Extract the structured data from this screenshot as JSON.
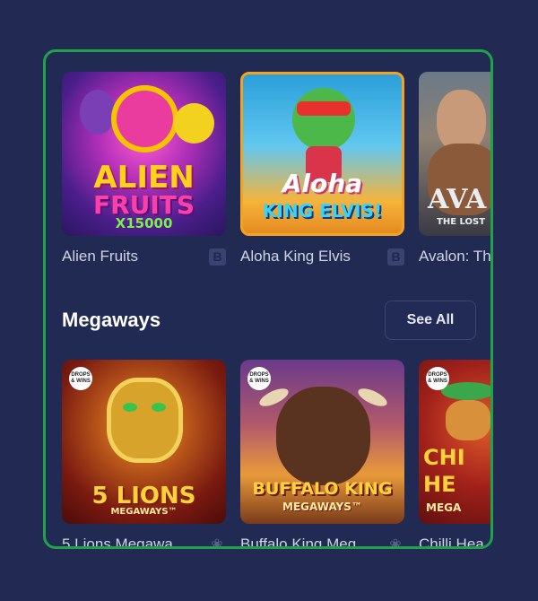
{
  "top_row": [
    {
      "name": "Alien Fruits",
      "provider_badge": "B",
      "art_line1": "ALIEN",
      "art_line2": "FRUITS",
      "art_line3": "X15000"
    },
    {
      "name": "Aloha King Elvis",
      "provider_badge": "B",
      "art_line1": "Aloha",
      "art_line2": "KING ELVIS!"
    },
    {
      "name": "Avalon: Th",
      "art_line1": "AVA",
      "art_line2": "THE LOST"
    }
  ],
  "section": {
    "title": "Megaways",
    "see_all": "See All"
  },
  "bottom_row": [
    {
      "name": "5 Lions Megawa",
      "badge_text": "DROPS & WINS",
      "art_line1": "5 LIONS",
      "art_line2": "MEGAWAYS™"
    },
    {
      "name": "Buffalo King Meg",
      "badge_text": "DROPS & WINS",
      "art_line1": "BUFFALO KING",
      "art_line2": "MEGAWAYS™"
    },
    {
      "name": "Chilli Hea",
      "badge_text": "DROPS & WINS",
      "art_line1": "CHI",
      "art_line2": "HE",
      "art_line3": "MEGA"
    }
  ],
  "icons": {
    "provider": "pepper-icon"
  }
}
